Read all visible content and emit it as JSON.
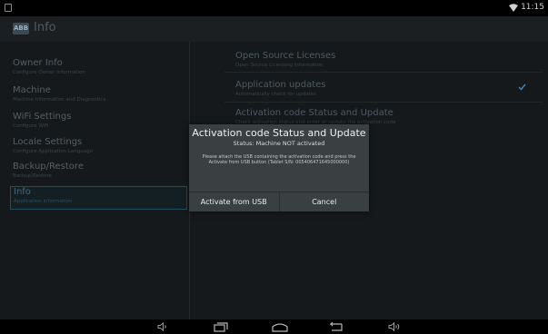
{
  "status_bar": {
    "time": "11:15"
  },
  "app_bar": {
    "logo_text": "ABB",
    "title": "Info"
  },
  "sidebar": {
    "items": [
      {
        "title": "Owner Info",
        "subtitle": "Configure Owner Information"
      },
      {
        "title": "Machine",
        "subtitle": "Machine Information and Diagnostics"
      },
      {
        "title": "WiFi Settings",
        "subtitle": "Configure WiFi"
      },
      {
        "title": "Locale Settings",
        "subtitle": "Configure Application Language"
      },
      {
        "title": "Backup/Restore",
        "subtitle": "Backup/Restore"
      },
      {
        "title": "Info",
        "subtitle": "Application information"
      }
    ]
  },
  "panel": {
    "items": [
      {
        "title": "Open Source Licenses",
        "subtitle": "Open Source Licensing Information"
      },
      {
        "title": "Application updates",
        "subtitle": "Automatically check for updates"
      },
      {
        "title": "Activation code Status and Update",
        "subtitle": "Check activation status and enter or update the activation code"
      }
    ]
  },
  "dialog": {
    "title": "Activation code Status and Update",
    "status": "Status: Machine NOT activated",
    "body": "Please attach the USB containing the activation code and press the Activate from USB button (Tablet S/N: 005406471645000000)",
    "activate_label": "Activate from USB",
    "cancel_label": "Cancel"
  },
  "colors": {
    "accent": "#1f4e63",
    "checkmark": "#3c88c4"
  },
  "icons": [
    "wifi-icon",
    "check-icon",
    "volume-down-icon",
    "recent-apps-icon",
    "home-icon",
    "back-icon",
    "volume-up-icon"
  ]
}
